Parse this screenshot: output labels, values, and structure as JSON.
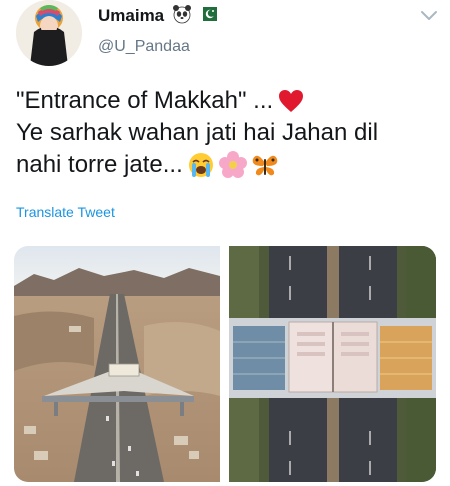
{
  "user": {
    "display_name": "Umaima",
    "handle": "@U_Pandaa",
    "name_emojis": [
      "panda-emoji",
      "pakistan-flag-emoji"
    ]
  },
  "tweet": {
    "line1": "\"Entrance of Makkah\" ...",
    "line2": "Ye sarhak wahan jati hai Jahan dil",
    "line3": "nahi  torre jate...",
    "line1_emojis": [
      "red-heart-emoji"
    ],
    "line3_emojis": [
      "crying-face-emoji",
      "cherry-blossom-emoji",
      "butterfly-emoji"
    ]
  },
  "translate_label": "Translate Tweet",
  "media": [
    {
      "name": "makkah-gate-aerial-photo"
    },
    {
      "name": "makkah-gate-top-down-photo"
    }
  ],
  "colors": {
    "text": "#14171a",
    "secondary": "#657786",
    "link": "#1b95e0"
  }
}
